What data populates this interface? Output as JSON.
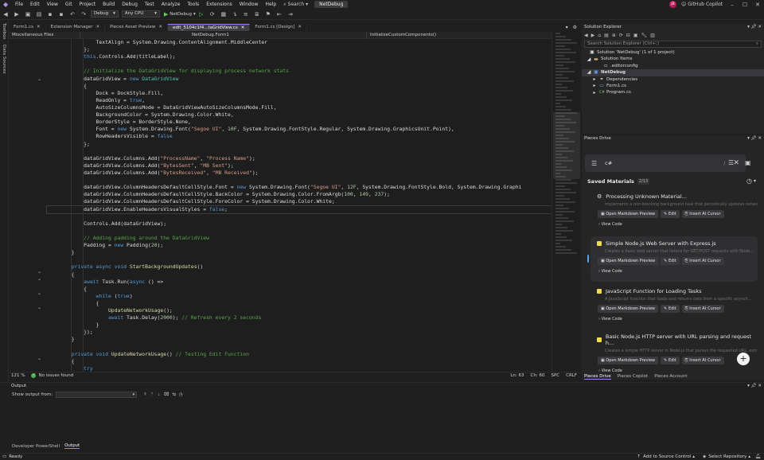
{
  "titlebar": {
    "menu": [
      "File",
      "Edit",
      "View",
      "Git",
      "Project",
      "Build",
      "Debug",
      "Test",
      "Analyze",
      "Tools",
      "Extensions",
      "Window",
      "Help"
    ],
    "search_label": "Search",
    "solution_name": "NetDebug",
    "avatar_initials": "JB",
    "copilot_label": "GitHub Copilot"
  },
  "toolbar": {
    "config": "Debug",
    "platform": "Any CPU",
    "run_target": "NetDebug"
  },
  "leftrail": [
    "Toolbox",
    "Data Sources"
  ],
  "doctabs": [
    {
      "label": "Form1.cs",
      "active": false
    },
    {
      "label": "Extension Manager",
      "active": false
    },
    {
      "label": "Pieces Asset Preview",
      "active": false
    },
    {
      "label": "edit_5104c1f4...taGridView.cs",
      "active": true
    },
    {
      "label": "Form1.cs [Design]",
      "active": false
    }
  ],
  "navbar": {
    "project": "Miscellaneous Files",
    "class": "NetDebug.Form1",
    "member": "InitializeCustomComponents()"
  },
  "code_lines": [
    [
      [
        "",
        "                TextAlign = System.Drawing.ContentAlignment.MiddleCenter"
      ]
    ],
    [
      [
        "",
        "            };"
      ]
    ],
    [
      [
        "k",
        "            this"
      ],
      [
        "",
        ".Controls.Add(titleLabel);"
      ]
    ],
    [
      [
        "",
        ""
      ]
    ],
    [
      [
        "c",
        "            // Initialize the DataGridView for displaying process network stats"
      ]
    ],
    [
      [
        "",
        "            dataGridView = "
      ],
      [
        "k",
        "new"
      ],
      [
        "t",
        " DataGridView"
      ]
    ],
    [
      [
        "",
        "            {"
      ]
    ],
    [
      [
        "",
        "                Dock = DockStyle.Fill,"
      ]
    ],
    [
      [
        "",
        "                ReadOnly = "
      ],
      [
        "k",
        "true"
      ],
      [
        "",
        ","
      ]
    ],
    [
      [
        "",
        "                AutoSizeColumnsMode = DataGridViewAutoSizeColumnsMode.Fill,"
      ]
    ],
    [
      [
        "",
        "                BackgroundColor = System.Drawing.Color.White,"
      ]
    ],
    [
      [
        "",
        "                BorderStyle = BorderStyle.None,"
      ]
    ],
    [
      [
        "",
        "                Font = "
      ],
      [
        "k",
        "new"
      ],
      [
        "",
        " System.Drawing.Font("
      ],
      [
        "s",
        "\"Segoe UI\""
      ],
      [
        "",
        ", "
      ],
      [
        "n",
        "10F"
      ],
      [
        "",
        ", System.Drawing.FontStyle.Regular, System.Drawing.GraphicsUnit.Point),"
      ]
    ],
    [
      [
        "",
        "                RowHeadersVisible = "
      ],
      [
        "k",
        "false"
      ]
    ],
    [
      [
        "",
        "            };"
      ]
    ],
    [
      [
        "",
        ""
      ]
    ],
    [
      [
        "",
        "            dataGridView.Columns.Add("
      ],
      [
        "s",
        "\"ProcessName\""
      ],
      [
        "",
        ", "
      ],
      [
        "s",
        "\"Process Name\""
      ],
      [
        "",
        ");"
      ]
    ],
    [
      [
        "",
        "            dataGridView.Columns.Add("
      ],
      [
        "s",
        "\"BytesSent\""
      ],
      [
        "",
        ", "
      ],
      [
        "s",
        "\"MB Sent\""
      ],
      [
        "",
        ");"
      ]
    ],
    [
      [
        "",
        "            dataGridView.Columns.Add("
      ],
      [
        "s",
        "\"BytesReceived\""
      ],
      [
        "",
        ", "
      ],
      [
        "s",
        "\"MB Received\""
      ],
      [
        "",
        ");"
      ]
    ],
    [
      [
        "",
        ""
      ]
    ],
    [
      [
        "",
        "            dataGridView.ColumnHeadersDefaultCellStyle.Font = "
      ],
      [
        "k",
        "new"
      ],
      [
        "",
        " System.Drawing.Font("
      ],
      [
        "s",
        "\"Segoe UI\""
      ],
      [
        "",
        ", "
      ],
      [
        "n",
        "12F"
      ],
      [
        "",
        ", System.Drawing.FontStyle.Bold, System.Drawing.Graphi"
      ]
    ],
    [
      [
        "",
        "            dataGridView.ColumnHeadersDefaultCellStyle.BackColor = System.Drawing.Color.FromArgb("
      ],
      [
        "n",
        "100"
      ],
      [
        "",
        ", "
      ],
      [
        "n",
        "149"
      ],
      [
        "",
        ", "
      ],
      [
        "n",
        "237"
      ],
      [
        "",
        ");"
      ]
    ],
    [
      [
        "",
        "            dataGridView.ColumnHeadersDefaultCellStyle.ForeColor = System.Drawing.Color.White;"
      ]
    ],
    [
      [
        "",
        "            dataGridView.EnableHeadersVisualStyles = "
      ],
      [
        "k",
        "false"
      ],
      [
        "",
        ";"
      ]
    ],
    [
      [
        "",
        ""
      ]
    ],
    [
      [
        "",
        "            Controls.Add(dataGridView);"
      ]
    ],
    [
      [
        "",
        ""
      ]
    ],
    [
      [
        "c",
        "            // Adding padding around the DataGridView"
      ]
    ],
    [
      [
        "",
        "            Padding = "
      ],
      [
        "k",
        "new"
      ],
      [
        "",
        " Padding("
      ],
      [
        "n",
        "20"
      ],
      [
        "",
        ");"
      ]
    ],
    [
      [
        "",
        "        }"
      ]
    ],
    [
      [
        "",
        ""
      ]
    ],
    [
      [
        "k",
        "        private async void"
      ],
      [
        "m",
        " StartBackgroundUpdates"
      ],
      [
        "",
        "()"
      ]
    ],
    [
      [
        "",
        "        {"
      ]
    ],
    [
      [
        "k",
        "            await"
      ],
      [
        "",
        " Task.Run("
      ],
      [
        "k",
        "async"
      ],
      [
        "",
        " () =>"
      ]
    ],
    [
      [
        "",
        "            {"
      ]
    ],
    [
      [
        "k",
        "                while"
      ],
      [
        "",
        " ("
      ],
      [
        "k",
        "true"
      ],
      [
        "",
        ")"
      ]
    ],
    [
      [
        "",
        "                {"
      ]
    ],
    [
      [
        "m",
        "                    UpdateNetworkUsage"
      ],
      [
        "",
        "();"
      ]
    ],
    [
      [
        "k",
        "                    await"
      ],
      [
        "",
        " Task.Delay("
      ],
      [
        "n",
        "2000"
      ],
      [
        "",
        "); "
      ],
      [
        "c",
        "// Refresh every 2 seconds"
      ]
    ],
    [
      [
        "",
        "                }"
      ]
    ],
    [
      [
        "",
        "            });"
      ]
    ],
    [
      [
        "",
        "        }"
      ]
    ],
    [
      [
        "",
        ""
      ]
    ],
    [
      [
        "k",
        "        private void"
      ],
      [
        "m",
        " UpdateNetworkUsage"
      ],
      [
        "",
        "() "
      ],
      [
        "c",
        "// Testing Edit Function"
      ]
    ],
    [
      [
        "",
        "        {"
      ]
    ],
    [
      [
        "k",
        "            try"
      ]
    ]
  ],
  "editor_status": {
    "zoom": "121 %",
    "issues": "No issues found",
    "ln": "Ln: 63",
    "ch": "Ch: 60",
    "ins": "SPC",
    "eol": "CRLF"
  },
  "solution_explorer": {
    "title": "Solution Explorer",
    "search_placeholder": "Search Solution Explorer (Ctrl+;)",
    "items": [
      {
        "label": "Solution 'NetDebug' (1 of 1 project)",
        "indent": 0,
        "icon": "solution-icon",
        "selected": false
      },
      {
        "label": "Solution Items",
        "indent": 1,
        "icon": "folder-icon",
        "selected": false
      },
      {
        "label": ".editorconfig",
        "indent": 2,
        "icon": "file-icon",
        "selected": false
      },
      {
        "label": "NetDebug",
        "indent": 1,
        "icon": "project-icon",
        "selected": true
      },
      {
        "label": "Dependencies",
        "indent": 2,
        "icon": "dependencies-icon",
        "selected": false
      },
      {
        "label": "Form1.cs",
        "indent": 2,
        "icon": "csharp-icon",
        "selected": false
      },
      {
        "label": "Program.cs",
        "indent": 2,
        "icon": "csharp-icon",
        "selected": false
      }
    ]
  },
  "pieces": {
    "title": "Pieces Drive",
    "search_value": "c#",
    "saved_label": "Saved Materials",
    "saved_count": "2/13",
    "buttons": {
      "preview": "Open Markdown Preview",
      "edit": "Edit",
      "insert": "Insert At Cursor",
      "view": "View Code"
    },
    "cards": [
      {
        "title": "Processing Unknown Material...",
        "desc": "Implements a non-blocking background task that periodically updates network usag...",
        "highlight": false,
        "icon": "gear-icon"
      },
      {
        "title": "Simple Node.js Web Server with Express.js",
        "desc": "Creates a basic web server that listens for GET/POST requests with Node...",
        "highlight": true,
        "icon": "js-icon"
      },
      {
        "title": "JavaScript Function for Loading Tasks",
        "desc": "A JavaScript function that loads and returns data from a specific asynch...",
        "highlight": false,
        "icon": "js-icon"
      },
      {
        "title": "Basic Node.js HTTP server with URL parsing and request h...",
        "desc": "Creates a simple HTTP server in Node.js that parses the requested URL, extracts ...",
        "highlight": false,
        "icon": "js-icon"
      }
    ],
    "tabs": [
      "Pieces Drive",
      "Pieces Copilot",
      "Pieces Account"
    ]
  },
  "output": {
    "title": "Output",
    "show_from_label": "Show output from:",
    "tabs": [
      "Developer PowerShell",
      "Output"
    ]
  },
  "statusbar": {
    "state": "Ready",
    "source_control": "Add to Source Control",
    "repository": "Select Repository"
  }
}
